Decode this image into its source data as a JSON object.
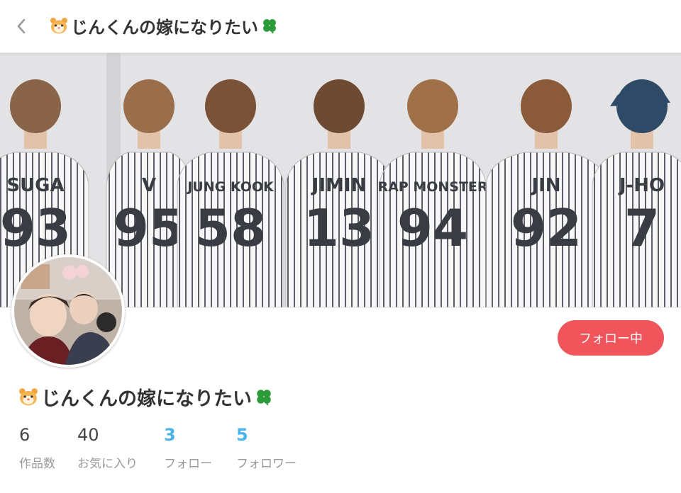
{
  "header": {
    "title": "じんくんの嫁になりたい",
    "back_icon": "chevron-left-icon",
    "prefix_icon": "hamster-face-icon",
    "suffix_icon": "four-leaf-clover-icon"
  },
  "cover": {
    "jerseys": [
      {
        "name": "SUGA",
        "number": "93"
      },
      {
        "name": "V",
        "number": "95"
      },
      {
        "name": "JUNG KOOK",
        "number": "58"
      },
      {
        "name": "JIMIN",
        "number": "13"
      },
      {
        "name": "RAP MONSTER",
        "number": "94"
      },
      {
        "name": "JIN",
        "number": "92"
      },
      {
        "name": "J-HO",
        "number": "7"
      }
    ]
  },
  "profile": {
    "name": "じんくんの嫁になりたい",
    "follow_button_label": "フォロー中"
  },
  "stats": [
    {
      "value": "6",
      "label": "作品数"
    },
    {
      "value": "40",
      "label": "お気に入り"
    },
    {
      "value": "3",
      "label": "フォロー"
    },
    {
      "value": "5",
      "label": "フォロワー"
    }
  ],
  "colors": {
    "accent_red": "#f0555b",
    "link_blue": "#4bb3e6",
    "clover_green": "#2e9b3a"
  }
}
